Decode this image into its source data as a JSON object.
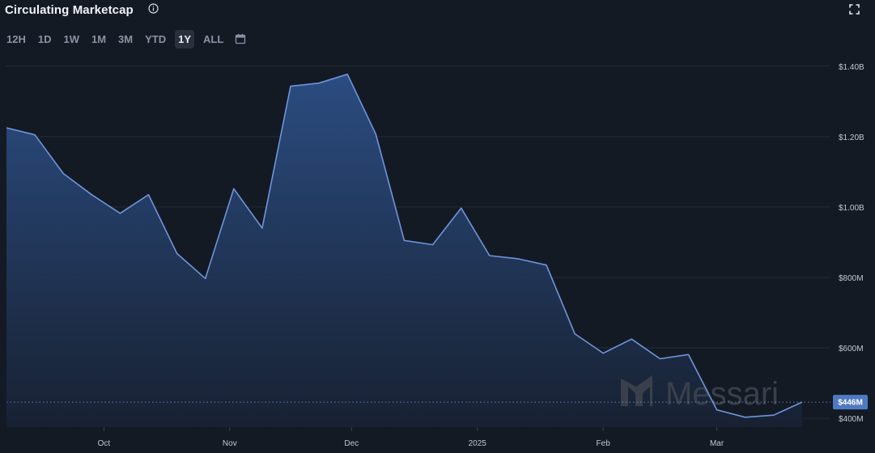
{
  "header": {
    "title": "Circulating Marketcap",
    "info_icon": "info-circle-icon",
    "expand_icon": "fullscreen-icon"
  },
  "ranges": {
    "items": [
      "12H",
      "1D",
      "1W",
      "1M",
      "3M",
      "YTD",
      "1Y",
      "ALL"
    ],
    "active": "1Y",
    "calendar_icon": "calendar-icon"
  },
  "watermark": {
    "text": "Messari",
    "icon": "messari-logo-icon"
  },
  "colors": {
    "background": "#141a24",
    "line": "#6f95dc",
    "area_top": "#2c4f86",
    "area_bottom": "#141a24",
    "grid": "#262c37",
    "badge": "#4f7ac2"
  },
  "chart_data": {
    "type": "area",
    "title": "Circulating Marketcap",
    "ylabel": "",
    "xlabel": "",
    "yunit": "USD",
    "ylim": [
      375000000,
      1450000000
    ],
    "xlim": [
      "2024-09-07",
      "2025-03-29"
    ],
    "yticks": [
      {
        "value": 1400000000,
        "label": "$1.40B"
      },
      {
        "value": 1200000000,
        "label": "$1.20B"
      },
      {
        "value": 1000000000,
        "label": "$1.00B"
      },
      {
        "value": 800000000,
        "label": "$800M"
      },
      {
        "value": 600000000,
        "label": "$600M"
      },
      {
        "value": 400000000,
        "label": "$400M"
      }
    ],
    "xticks": [
      {
        "date": "2024-10-01",
        "label": "Oct"
      },
      {
        "date": "2024-11-01",
        "label": "Nov"
      },
      {
        "date": "2024-12-01",
        "label": "Dec"
      },
      {
        "date": "2025-01-01",
        "label": "2025"
      },
      {
        "date": "2025-02-01",
        "label": "Feb"
      },
      {
        "date": "2025-03-01",
        "label": "Mar"
      }
    ],
    "current": {
      "value": 446000000,
      "label": "$446M"
    },
    "grid": true,
    "legend": "none",
    "series": [
      {
        "points": [
          {
            "x": "2024-09-07",
            "y": 1225000000
          },
          {
            "x": "2024-09-14",
            "y": 1205000000
          },
          {
            "x": "2024-09-21",
            "y": 1095000000
          },
          {
            "x": "2024-09-28",
            "y": 1035000000
          },
          {
            "x": "2024-10-05",
            "y": 982000000
          },
          {
            "x": "2024-10-12",
            "y": 1035000000
          },
          {
            "x": "2024-10-19",
            "y": 868000000
          },
          {
            "x": "2024-10-26",
            "y": 797000000
          },
          {
            "x": "2024-11-02",
            "y": 1052000000
          },
          {
            "x": "2024-11-09",
            "y": 940000000
          },
          {
            "x": "2024-11-16",
            "y": 1343000000
          },
          {
            "x": "2024-11-23",
            "y": 1352000000
          },
          {
            "x": "2024-11-30",
            "y": 1377000000
          },
          {
            "x": "2024-12-07",
            "y": 1207000000
          },
          {
            "x": "2024-12-14",
            "y": 905000000
          },
          {
            "x": "2024-12-21",
            "y": 893000000
          },
          {
            "x": "2024-12-28",
            "y": 997000000
          },
          {
            "x": "2025-01-04",
            "y": 862000000
          },
          {
            "x": "2025-01-11",
            "y": 853000000
          },
          {
            "x": "2025-01-18",
            "y": 835000000
          },
          {
            "x": "2025-01-25",
            "y": 640000000
          },
          {
            "x": "2025-02-01",
            "y": 585000000
          },
          {
            "x": "2025-02-08",
            "y": 625000000
          },
          {
            "x": "2025-02-15",
            "y": 569000000
          },
          {
            "x": "2025-02-22",
            "y": 581000000
          },
          {
            "x": "2025-03-01",
            "y": 424000000
          },
          {
            "x": "2025-03-08",
            "y": 403000000
          },
          {
            "x": "2025-03-15",
            "y": 409000000
          },
          {
            "x": "2025-03-22",
            "y": 446000000
          }
        ]
      }
    ]
  }
}
